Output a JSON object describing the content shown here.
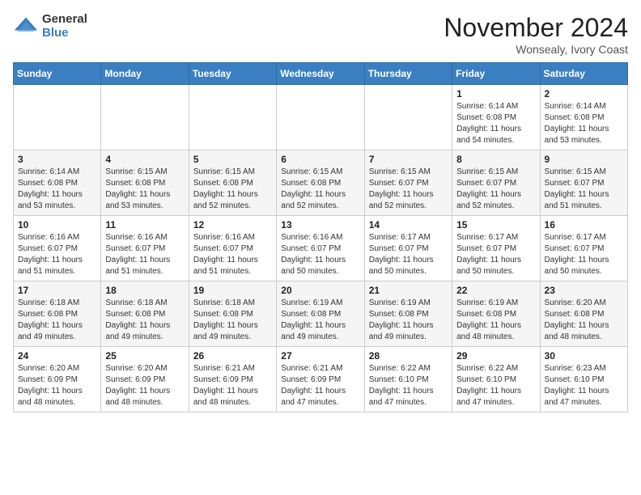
{
  "logo": {
    "general": "General",
    "blue": "Blue"
  },
  "header": {
    "month": "November 2024",
    "location": "Wonsealy, Ivory Coast"
  },
  "weekdays": [
    "Sunday",
    "Monday",
    "Tuesday",
    "Wednesday",
    "Thursday",
    "Friday",
    "Saturday"
  ],
  "weeks": [
    [
      {
        "day": "",
        "info": ""
      },
      {
        "day": "",
        "info": ""
      },
      {
        "day": "",
        "info": ""
      },
      {
        "day": "",
        "info": ""
      },
      {
        "day": "",
        "info": ""
      },
      {
        "day": "1",
        "info": "Sunrise: 6:14 AM\nSunset: 6:08 PM\nDaylight: 11 hours and 54 minutes."
      },
      {
        "day": "2",
        "info": "Sunrise: 6:14 AM\nSunset: 6:08 PM\nDaylight: 11 hours and 53 minutes."
      }
    ],
    [
      {
        "day": "3",
        "info": "Sunrise: 6:14 AM\nSunset: 6:08 PM\nDaylight: 11 hours and 53 minutes."
      },
      {
        "day": "4",
        "info": "Sunrise: 6:15 AM\nSunset: 6:08 PM\nDaylight: 11 hours and 53 minutes."
      },
      {
        "day": "5",
        "info": "Sunrise: 6:15 AM\nSunset: 6:08 PM\nDaylight: 11 hours and 52 minutes."
      },
      {
        "day": "6",
        "info": "Sunrise: 6:15 AM\nSunset: 6:08 PM\nDaylight: 11 hours and 52 minutes."
      },
      {
        "day": "7",
        "info": "Sunrise: 6:15 AM\nSunset: 6:07 PM\nDaylight: 11 hours and 52 minutes."
      },
      {
        "day": "8",
        "info": "Sunrise: 6:15 AM\nSunset: 6:07 PM\nDaylight: 11 hours and 52 minutes."
      },
      {
        "day": "9",
        "info": "Sunrise: 6:15 AM\nSunset: 6:07 PM\nDaylight: 11 hours and 51 minutes."
      }
    ],
    [
      {
        "day": "10",
        "info": "Sunrise: 6:16 AM\nSunset: 6:07 PM\nDaylight: 11 hours and 51 minutes."
      },
      {
        "day": "11",
        "info": "Sunrise: 6:16 AM\nSunset: 6:07 PM\nDaylight: 11 hours and 51 minutes."
      },
      {
        "day": "12",
        "info": "Sunrise: 6:16 AM\nSunset: 6:07 PM\nDaylight: 11 hours and 51 minutes."
      },
      {
        "day": "13",
        "info": "Sunrise: 6:16 AM\nSunset: 6:07 PM\nDaylight: 11 hours and 50 minutes."
      },
      {
        "day": "14",
        "info": "Sunrise: 6:17 AM\nSunset: 6:07 PM\nDaylight: 11 hours and 50 minutes."
      },
      {
        "day": "15",
        "info": "Sunrise: 6:17 AM\nSunset: 6:07 PM\nDaylight: 11 hours and 50 minutes."
      },
      {
        "day": "16",
        "info": "Sunrise: 6:17 AM\nSunset: 6:07 PM\nDaylight: 11 hours and 50 minutes."
      }
    ],
    [
      {
        "day": "17",
        "info": "Sunrise: 6:18 AM\nSunset: 6:08 PM\nDaylight: 11 hours and 49 minutes."
      },
      {
        "day": "18",
        "info": "Sunrise: 6:18 AM\nSunset: 6:08 PM\nDaylight: 11 hours and 49 minutes."
      },
      {
        "day": "19",
        "info": "Sunrise: 6:18 AM\nSunset: 6:08 PM\nDaylight: 11 hours and 49 minutes."
      },
      {
        "day": "20",
        "info": "Sunrise: 6:19 AM\nSunset: 6:08 PM\nDaylight: 11 hours and 49 minutes."
      },
      {
        "day": "21",
        "info": "Sunrise: 6:19 AM\nSunset: 6:08 PM\nDaylight: 11 hours and 49 minutes."
      },
      {
        "day": "22",
        "info": "Sunrise: 6:19 AM\nSunset: 6:08 PM\nDaylight: 11 hours and 48 minutes."
      },
      {
        "day": "23",
        "info": "Sunrise: 6:20 AM\nSunset: 6:08 PM\nDaylight: 11 hours and 48 minutes."
      }
    ],
    [
      {
        "day": "24",
        "info": "Sunrise: 6:20 AM\nSunset: 6:09 PM\nDaylight: 11 hours and 48 minutes."
      },
      {
        "day": "25",
        "info": "Sunrise: 6:20 AM\nSunset: 6:09 PM\nDaylight: 11 hours and 48 minutes."
      },
      {
        "day": "26",
        "info": "Sunrise: 6:21 AM\nSunset: 6:09 PM\nDaylight: 11 hours and 48 minutes."
      },
      {
        "day": "27",
        "info": "Sunrise: 6:21 AM\nSunset: 6:09 PM\nDaylight: 11 hours and 47 minutes."
      },
      {
        "day": "28",
        "info": "Sunrise: 6:22 AM\nSunset: 6:10 PM\nDaylight: 11 hours and 47 minutes."
      },
      {
        "day": "29",
        "info": "Sunrise: 6:22 AM\nSunset: 6:10 PM\nDaylight: 11 hours and 47 minutes."
      },
      {
        "day": "30",
        "info": "Sunrise: 6:23 AM\nSunset: 6:10 PM\nDaylight: 11 hours and 47 minutes."
      }
    ]
  ]
}
